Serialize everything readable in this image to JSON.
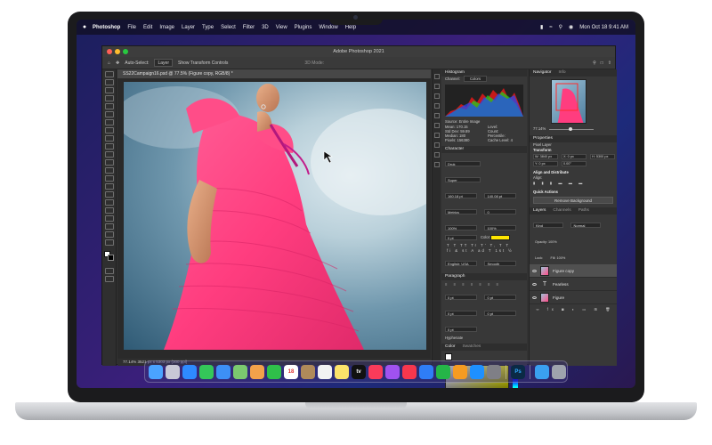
{
  "menubar": {
    "apple_icon": "apple-icon",
    "app_name": "Photoshop",
    "items": [
      "File",
      "Edit",
      "Image",
      "Layer",
      "Type",
      "Select",
      "Filter",
      "3D",
      "View",
      "Plugins",
      "Window",
      "Help"
    ],
    "clock": "Mon Oct 18  9:41 AM"
  },
  "window": {
    "title": "Adobe Photoshop 2021",
    "options_bar": {
      "auto_select_label": "Auto-Select:",
      "auto_select_value": "Layer",
      "show_transform_label": "Show Transform Controls",
      "mode_3d": "3D Mode:"
    },
    "document_tab": "SS22Campaign16.psd @ 77.5% (Figure copy, RGB/8) *",
    "status": "77.14%    3521 px x 5303 px (300 ppi)"
  },
  "panels": {
    "histogram": {
      "tabs": [
        "Histogram"
      ],
      "channel_label": "Channel:",
      "channel_value": "Colors",
      "source_label": "Source:",
      "source_value": "Entire Image",
      "stats_left": [
        "Mean: 170.15",
        "Std Dev: 59.89",
        "Median: 180",
        "Pixels: 156380"
      ],
      "stats_right": [
        "Level:",
        "Count:",
        "Percentile:",
        "Cache Level: 4"
      ]
    },
    "character": {
      "tab": "Character",
      "font_family": "Druk",
      "font_style": "Super",
      "font_size": "160.18 pt",
      "leading": "140.08 pt",
      "kerning": "Metrics",
      "tracking": "0",
      "vertical_scale": "100%",
      "horizontal_scale": "100%",
      "baseline": "0 pt",
      "color_label": "Color:",
      "text_color": "#ffe600",
      "language": "English: USA",
      "anti_alias": "Smooth"
    },
    "paragraph": {
      "tab": "Paragraph",
      "indent_left": "0 pt",
      "indent_right": "0 pt",
      "indent_first": "0 pt",
      "space_before": "0 pt",
      "space_after": "0 pt",
      "hyphenate": "Hyphenate"
    },
    "color": {
      "tabs": [
        "Color",
        "Swatches"
      ]
    },
    "navigator": {
      "tabs": [
        "Navigator",
        "Info"
      ],
      "zoom": "77.14%"
    },
    "properties": {
      "tab": "Properties",
      "kind": "Pixel Layer",
      "transform_label": "Transform",
      "w": "W: 3840 px",
      "h": "H: 5300 px",
      "x": "X: 0 px",
      "y": "Y: 0 px",
      "angle": "0.00°",
      "align_label": "Align and Distribute",
      "align_sub": "Align:",
      "quick_actions_label": "Quick Actions",
      "remove_bg": "Remove Background"
    },
    "layers": {
      "tabs": [
        "Layers",
        "Channels",
        "Paths"
      ],
      "filter": "Kind",
      "blend": "Normal",
      "opacity": "Opacity: 100%",
      "lock_label": "Lock:",
      "fill": "Fill: 100%",
      "items": [
        {
          "name": "Figure copy",
          "selected": true
        },
        {
          "name": "Fearless",
          "selected": false
        },
        {
          "name": "Figure",
          "selected": false
        }
      ]
    }
  },
  "dock": {
    "items": [
      {
        "name": "finder-icon",
        "color": "#4aa3ff",
        "glyph": ""
      },
      {
        "name": "launchpad-icon",
        "color": "#c8c8d6",
        "glyph": ""
      },
      {
        "name": "safari-icon",
        "color": "#2e8bff",
        "glyph": ""
      },
      {
        "name": "messages-icon",
        "color": "#34c759",
        "glyph": ""
      },
      {
        "name": "mail-icon",
        "color": "#3d8ff5",
        "glyph": ""
      },
      {
        "name": "maps-icon",
        "color": "#7bc96f",
        "glyph": ""
      },
      {
        "name": "photos-icon",
        "color": "#f3a14a",
        "glyph": ""
      },
      {
        "name": "facetime-icon",
        "color": "#2fbf4a",
        "glyph": ""
      },
      {
        "name": "calendar-icon",
        "color": "#ffffff",
        "glyph": "18"
      },
      {
        "name": "contacts-icon",
        "color": "#b08a5a",
        "glyph": ""
      },
      {
        "name": "reminders-icon",
        "color": "#f2f2f2",
        "glyph": ""
      },
      {
        "name": "notes-icon",
        "color": "#fce36a",
        "glyph": ""
      },
      {
        "name": "appletv-icon",
        "color": "#111111",
        "glyph": "tv"
      },
      {
        "name": "music-icon",
        "color": "#fa3b5a",
        "glyph": ""
      },
      {
        "name": "podcasts-icon",
        "color": "#a052f0",
        "glyph": ""
      },
      {
        "name": "news-icon",
        "color": "#f7374d",
        "glyph": ""
      },
      {
        "name": "keynote-icon",
        "color": "#2f7df6",
        "glyph": ""
      },
      {
        "name": "numbers-icon",
        "color": "#25b548",
        "glyph": ""
      },
      {
        "name": "pages-icon",
        "color": "#f59b22",
        "glyph": ""
      },
      {
        "name": "appstore-icon",
        "color": "#1e90ff",
        "glyph": ""
      },
      {
        "name": "system-preferences-icon",
        "color": "#7f7f86",
        "glyph": ""
      },
      {
        "name": "photoshop-icon",
        "color": "#0b2a45",
        "glyph": "Ps"
      },
      {
        "name": "downloads-folder-icon",
        "color": "#3aa0f0",
        "glyph": ""
      },
      {
        "name": "trash-icon",
        "color": "#9ea3ad",
        "glyph": ""
      }
    ]
  }
}
